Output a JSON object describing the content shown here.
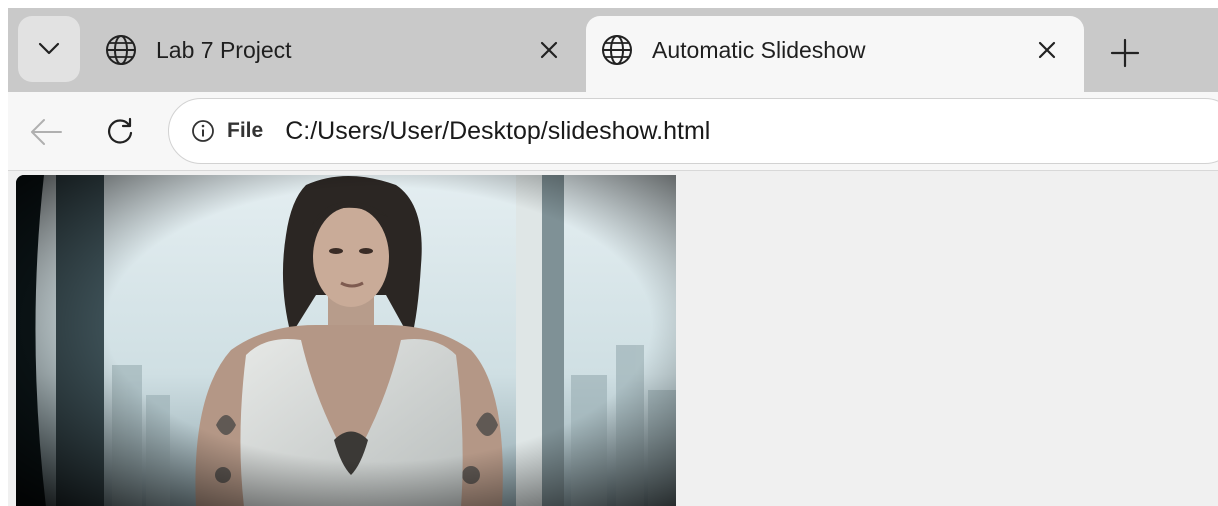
{
  "tabs": [
    {
      "title": "Lab 7 Project",
      "icon": "globe-icon",
      "active": false
    },
    {
      "title": "Automatic Slideshow",
      "icon": "globe-icon",
      "active": true
    }
  ],
  "toolbar": {
    "scheme_label": "File",
    "url": "C:/Users/User/Desktop/slideshow.html"
  },
  "colors": {
    "tabstrip": "#c9c9c9",
    "active_tab": "#f7f7f7",
    "page_background": "#f0f0f0"
  }
}
